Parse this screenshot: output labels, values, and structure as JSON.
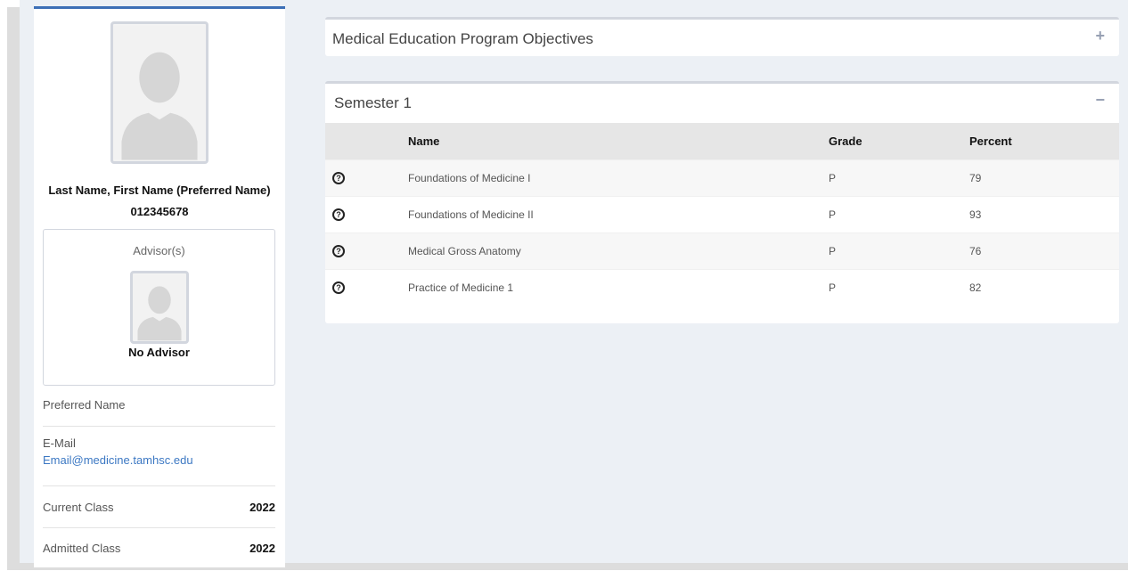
{
  "profile": {
    "name": "Last Name, First Name (Preferred Name)",
    "id": "012345678",
    "advisor_title": "Advisor(s)",
    "advisor_name": "No Advisor",
    "preferred_name_label": "Preferred Name",
    "email_label": "E-Mail",
    "email": "Email@medicine.tamhsc.edu",
    "current_class_label": "Current Class",
    "current_class": "2022",
    "admitted_class_label": "Admitted Class",
    "admitted_class": "2022"
  },
  "objectives": {
    "title": "Medical Education Program Objectives",
    "tool": "+"
  },
  "semester": {
    "title": "Semester 1",
    "tool": "−",
    "headers": {
      "name": "Name",
      "grade": "Grade",
      "percent": "Percent"
    },
    "help_icon": "?",
    "rows": [
      {
        "name": "Foundations of Medicine I",
        "grade": "P",
        "percent": "79"
      },
      {
        "name": "Foundations of Medicine II",
        "grade": "P",
        "percent": "93"
      },
      {
        "name": "Medical Gross Anatomy",
        "grade": "P",
        "percent": "76"
      },
      {
        "name": "Practice of Medicine 1",
        "grade": "P",
        "percent": "82"
      }
    ]
  },
  "colors": {
    "accent": "#3c6fb6",
    "link": "#3c78c3",
    "background": "#ecf0f5"
  }
}
